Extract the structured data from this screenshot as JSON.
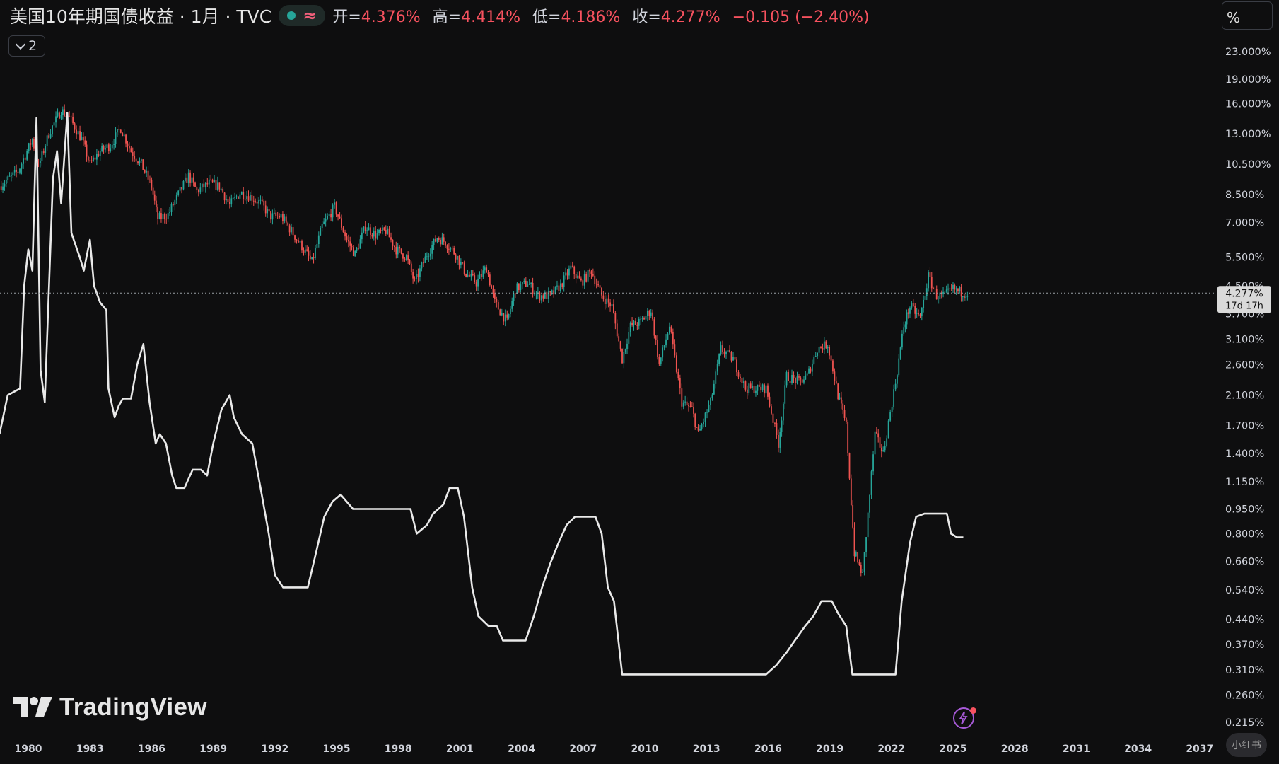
{
  "header": {
    "symbol_title": "美国10年期国债收益 · 1月 · TVC",
    "approx_icon": "≈",
    "ohlc": [
      {
        "label": "开=",
        "value": "4.376%"
      },
      {
        "label": "高=",
        "value": "4.414%"
      },
      {
        "label": "低=",
        "value": "4.186%"
      },
      {
        "label": "收=",
        "value": "4.277%"
      },
      {
        "label": "",
        "value": "−0.105 (−2.40%)"
      }
    ],
    "collapse_count": "2",
    "scale_mode": "%"
  },
  "branding": {
    "logo_text": "TradingView",
    "corner_badge": "小红书"
  },
  "colors": {
    "up": "#26a69a",
    "down": "#ef5350",
    "line": "#e9e9e9",
    "bg": "#0e0e0f"
  },
  "chart_data": {
    "type": "line",
    "y_scale": "log",
    "y_ticks": [
      23,
      19,
      16,
      13,
      10.5,
      8.5,
      7,
      5.5,
      4.5,
      3.7,
      3.1,
      2.6,
      2.1,
      1.7,
      1.4,
      1.15,
      0.95,
      0.8,
      0.66,
      0.54,
      0.44,
      0.37,
      0.31,
      0.26,
      0.215
    ],
    "y_tick_labels": [
      "23.000%",
      "19.000%",
      "16.000%",
      "13.000%",
      "10.500%",
      "8.500%",
      "7.000%",
      "5.500%",
      "4.500%",
      "3.700%",
      "3.100%",
      "2.600%",
      "2.100%",
      "1.700%",
      "1.400%",
      "1.150%",
      "0.950%",
      "0.800%",
      "0.660%",
      "0.540%",
      "0.440%",
      "0.370%",
      "0.310%",
      "0.260%",
      "0.215%"
    ],
    "x_ticks": [
      "1980",
      "1983",
      "1986",
      "1989",
      "1992",
      "1995",
      "1998",
      "2001",
      "2004",
      "2007",
      "2010",
      "2013",
      "2016",
      "2019",
      "2022",
      "2025",
      "2028",
      "2031",
      "2034",
      "2037"
    ],
    "last_price": {
      "value": 4.277,
      "label": "4.277%",
      "countdown": "17d 17h"
    },
    "series": [
      {
        "kind": "candles",
        "points": [
          [
            1978.6,
            9.0
          ],
          [
            1979.5,
            10.0
          ],
          [
            1980.2,
            12.5
          ],
          [
            1980.5,
            10.3
          ],
          [
            1981.0,
            13.0
          ],
          [
            1981.6,
            15.3
          ],
          [
            1982.0,
            14.5
          ],
          [
            1982.6,
            12.5
          ],
          [
            1983.0,
            10.5
          ],
          [
            1983.5,
            11.5
          ],
          [
            1984.0,
            12.0
          ],
          [
            1984.5,
            13.5
          ],
          [
            1985.0,
            11.5
          ],
          [
            1985.5,
            10.5
          ],
          [
            1986.0,
            9.0
          ],
          [
            1986.3,
            7.2
          ],
          [
            1986.8,
            7.4
          ],
          [
            1987.3,
            8.5
          ],
          [
            1987.8,
            9.7
          ],
          [
            1988.2,
            8.7
          ],
          [
            1988.8,
            9.2
          ],
          [
            1989.3,
            9.0
          ],
          [
            1989.8,
            7.9
          ],
          [
            1990.3,
            8.6
          ],
          [
            1990.8,
            8.4
          ],
          [
            1991.3,
            8.0
          ],
          [
            1991.8,
            7.3
          ],
          [
            1992.3,
            7.3
          ],
          [
            1992.8,
            6.6
          ],
          [
            1993.4,
            5.8
          ],
          [
            1993.8,
            5.3
          ],
          [
            1994.3,
            6.8
          ],
          [
            1994.9,
            7.8
          ],
          [
            1995.5,
            6.2
          ],
          [
            1995.9,
            5.6
          ],
          [
            1996.4,
            6.8
          ],
          [
            1996.9,
            6.4
          ],
          [
            1997.4,
            6.6
          ],
          [
            1997.9,
            5.8
          ],
          [
            1998.4,
            5.5
          ],
          [
            1998.8,
            4.6
          ],
          [
            1999.4,
            5.6
          ],
          [
            1999.9,
            6.3
          ],
          [
            2000.3,
            6.1
          ],
          [
            2000.8,
            5.6
          ],
          [
            2001.3,
            4.9
          ],
          [
            2001.8,
            4.6
          ],
          [
            2002.3,
            5.1
          ],
          [
            2002.7,
            4.0
          ],
          [
            2003.3,
            3.5
          ],
          [
            2003.7,
            4.4
          ],
          [
            2004.3,
            4.6
          ],
          [
            2004.8,
            4.2
          ],
          [
            2005.4,
            4.2
          ],
          [
            2005.9,
            4.5
          ],
          [
            2006.4,
            5.1
          ],
          [
            2006.9,
            4.6
          ],
          [
            2007.4,
            5.0
          ],
          [
            2007.9,
            4.2
          ],
          [
            2008.4,
            3.9
          ],
          [
            2008.9,
            2.7
          ],
          [
            2009.3,
            3.4
          ],
          [
            2009.8,
            3.5
          ],
          [
            2010.3,
            3.8
          ],
          [
            2010.7,
            2.6
          ],
          [
            2011.2,
            3.4
          ],
          [
            2011.8,
            2.0
          ],
          [
            2012.3,
            1.9
          ],
          [
            2012.6,
            1.6
          ],
          [
            2013.2,
            2.0
          ],
          [
            2013.7,
            2.9
          ],
          [
            2014.3,
            2.7
          ],
          [
            2014.9,
            2.2
          ],
          [
            2015.4,
            2.2
          ],
          [
            2015.9,
            2.2
          ],
          [
            2016.5,
            1.5
          ],
          [
            2016.9,
            2.4
          ],
          [
            2017.5,
            2.3
          ],
          [
            2017.9,
            2.4
          ],
          [
            2018.4,
            2.9
          ],
          [
            2018.9,
            3.0
          ],
          [
            2019.4,
            2.1
          ],
          [
            2019.8,
            1.7
          ],
          [
            2020.2,
            0.7
          ],
          [
            2020.6,
            0.6
          ],
          [
            2021.2,
            1.6
          ],
          [
            2021.6,
            1.4
          ],
          [
            2022.2,
            2.3
          ],
          [
            2022.6,
            3.4
          ],
          [
            2022.9,
            3.9
          ],
          [
            2023.4,
            3.6
          ],
          [
            2023.8,
            4.8
          ],
          [
            2024.2,
            4.2
          ],
          [
            2024.6,
            4.2
          ],
          [
            2025.0,
            4.4
          ],
          [
            2025.4,
            4.3
          ],
          [
            2025.7,
            4.28
          ]
        ]
      },
      {
        "kind": "line",
        "points": [
          [
            1978.6,
            1.6
          ],
          [
            1979.0,
            2.1
          ],
          [
            1979.6,
            2.2
          ],
          [
            1979.8,
            4.5
          ],
          [
            1980.0,
            5.8
          ],
          [
            1980.2,
            5.0
          ],
          [
            1980.4,
            14.5
          ],
          [
            1980.6,
            2.5
          ],
          [
            1980.8,
            2.0
          ],
          [
            1981.2,
            9.5
          ],
          [
            1981.4,
            11.5
          ],
          [
            1981.6,
            8.0
          ],
          [
            1981.9,
            15.0
          ],
          [
            1982.1,
            6.5
          ],
          [
            1982.5,
            5.5
          ],
          [
            1982.7,
            5.0
          ],
          [
            1983.0,
            6.2
          ],
          [
            1983.2,
            4.5
          ],
          [
            1983.5,
            4.0
          ],
          [
            1983.8,
            3.8
          ],
          [
            1983.9,
            2.2
          ],
          [
            1984.2,
            1.8
          ],
          [
            1984.4,
            1.95
          ],
          [
            1984.6,
            2.05
          ],
          [
            1985.0,
            2.05
          ],
          [
            1985.3,
            2.6
          ],
          [
            1985.6,
            3.0
          ],
          [
            1985.9,
            2.0
          ],
          [
            1986.2,
            1.5
          ],
          [
            1986.4,
            1.6
          ],
          [
            1986.7,
            1.5
          ],
          [
            1987.0,
            1.2
          ],
          [
            1987.2,
            1.1
          ],
          [
            1987.6,
            1.1
          ],
          [
            1988.0,
            1.25
          ],
          [
            1988.4,
            1.25
          ],
          [
            1988.7,
            1.2
          ],
          [
            1989.0,
            1.5
          ],
          [
            1989.4,
            1.9
          ],
          [
            1989.8,
            2.1
          ],
          [
            1990.0,
            1.8
          ],
          [
            1990.4,
            1.6
          ],
          [
            1990.9,
            1.5
          ],
          [
            1991.3,
            1.1
          ],
          [
            1991.7,
            0.8
          ],
          [
            1992.0,
            0.6
          ],
          [
            1992.4,
            0.55
          ],
          [
            1993.0,
            0.55
          ],
          [
            1993.6,
            0.55
          ],
          [
            1994.0,
            0.7
          ],
          [
            1994.4,
            0.9
          ],
          [
            1994.8,
            1.0
          ],
          [
            1995.2,
            1.05
          ],
          [
            1995.8,
            0.95
          ],
          [
            1996.5,
            0.95
          ],
          [
            1997.1,
            0.95
          ],
          [
            1997.6,
            0.95
          ],
          [
            1998.0,
            0.95
          ],
          [
            1998.6,
            0.95
          ],
          [
            1998.9,
            0.8
          ],
          [
            1999.4,
            0.85
          ],
          [
            1999.7,
            0.92
          ],
          [
            2000.2,
            0.98
          ],
          [
            2000.5,
            1.1
          ],
          [
            2000.9,
            1.1
          ],
          [
            2001.2,
            0.9
          ],
          [
            2001.6,
            0.55
          ],
          [
            2001.9,
            0.45
          ],
          [
            2002.4,
            0.42
          ],
          [
            2002.8,
            0.42
          ],
          [
            2003.1,
            0.38
          ],
          [
            2003.6,
            0.38
          ],
          [
            2004.2,
            0.38
          ],
          [
            2004.6,
            0.45
          ],
          [
            2005.0,
            0.55
          ],
          [
            2005.4,
            0.65
          ],
          [
            2005.8,
            0.75
          ],
          [
            2006.2,
            0.85
          ],
          [
            2006.6,
            0.9
          ],
          [
            2007.2,
            0.9
          ],
          [
            2007.6,
            0.9
          ],
          [
            2007.9,
            0.8
          ],
          [
            2008.2,
            0.55
          ],
          [
            2008.5,
            0.5
          ],
          [
            2008.9,
            0.3
          ],
          [
            2009.5,
            0.3
          ],
          [
            2010.5,
            0.3
          ],
          [
            2011.5,
            0.3
          ],
          [
            2012.5,
            0.3
          ],
          [
            2013.5,
            0.3
          ],
          [
            2014.5,
            0.3
          ],
          [
            2015.9,
            0.3
          ],
          [
            2016.4,
            0.32
          ],
          [
            2016.9,
            0.35
          ],
          [
            2017.3,
            0.38
          ],
          [
            2017.8,
            0.42
          ],
          [
            2018.2,
            0.45
          ],
          [
            2018.6,
            0.5
          ],
          [
            2019.1,
            0.5
          ],
          [
            2019.4,
            0.46
          ],
          [
            2019.8,
            0.42
          ],
          [
            2020.1,
            0.3
          ],
          [
            2020.6,
            0.3
          ],
          [
            2021.2,
            0.3
          ],
          [
            2021.8,
            0.3
          ],
          [
            2022.2,
            0.3
          ],
          [
            2022.5,
            0.5
          ],
          [
            2022.9,
            0.75
          ],
          [
            2023.2,
            0.9
          ],
          [
            2023.6,
            0.92
          ],
          [
            2024.2,
            0.92
          ],
          [
            2024.7,
            0.92
          ],
          [
            2024.9,
            0.8
          ],
          [
            2025.2,
            0.78
          ],
          [
            2025.5,
            0.78
          ]
        ]
      }
    ]
  }
}
